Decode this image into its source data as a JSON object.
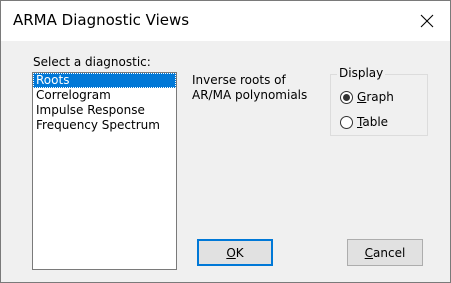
{
  "window": {
    "title": "ARMA Diagnostic Views",
    "close_glyph": "✕"
  },
  "diagnostic_list": {
    "label": "Select a diagnostic:",
    "items": [
      {
        "label": "Roots",
        "selected": true
      },
      {
        "label": "Correlogram",
        "selected": false
      },
      {
        "label": "Impulse Response",
        "selected": false
      },
      {
        "label": "Frequency Spectrum",
        "selected": false
      }
    ]
  },
  "description": {
    "line1": "Inverse roots of",
    "line2": "AR/MA polynomials"
  },
  "display": {
    "legend": "Display",
    "options": [
      {
        "mnemonic": "G",
        "rest": "raph",
        "checked": true
      },
      {
        "mnemonic": "T",
        "rest": "able",
        "checked": false
      }
    ]
  },
  "buttons": {
    "ok": {
      "mnemonic": "O",
      "rest": "K"
    },
    "cancel": {
      "mnemonic": "C",
      "rest": "ancel"
    }
  },
  "colors": {
    "selection": "#0078d7",
    "default_button_border": "#0078d7",
    "dialog_bg": "#f0f0f0"
  }
}
